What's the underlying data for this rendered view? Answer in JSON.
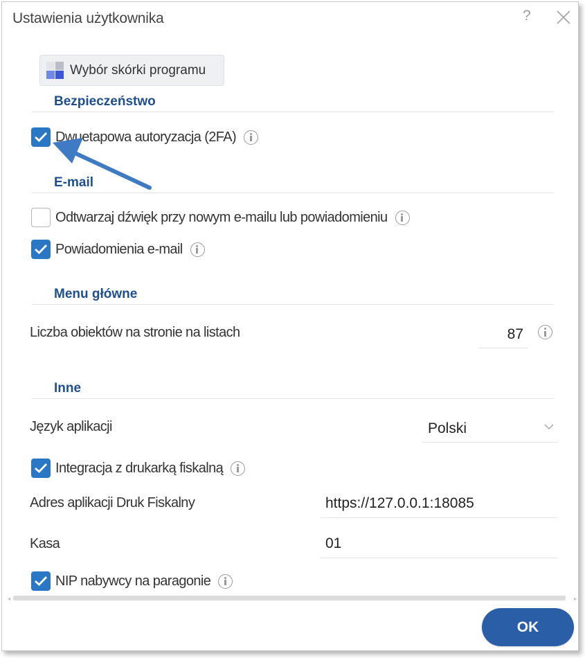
{
  "window": {
    "title": "Ustawienia użytkownika",
    "help_label": "?"
  },
  "skin_button": {
    "label": "Wybór skórki programu",
    "icon": "skin-palette-icon"
  },
  "sections": {
    "security": {
      "title": "Bezpieczeństwo",
      "two_factor": {
        "label": "Dwuetapowa autoryzacja (2FA)",
        "checked": true
      }
    },
    "email": {
      "title": "E-mail",
      "sound": {
        "label": "Odtwarzaj dźwięk przy nowym e-mailu lub powiadomieniu",
        "checked": false
      },
      "notifications": {
        "label": "Powiadomienia e-mail",
        "checked": true
      }
    },
    "main_menu": {
      "title": "Menu główne",
      "items_per_page": {
        "label": "Liczba obiektów na stronie na listach",
        "value": "87"
      }
    },
    "other": {
      "title": "Inne",
      "language": {
        "label": "Język aplikacji",
        "value": "Polski"
      },
      "fiscal_printer": {
        "label": "Integracja z drukarką fiskalną",
        "checked": true
      },
      "fiscal_address": {
        "label": "Adres aplikacji Druk Fiskalny",
        "value": "https://127.0.0.1:18085"
      },
      "register": {
        "label": "Kasa",
        "value": "01"
      },
      "buyer_nip": {
        "label": "NIP nabywcy na paragonie",
        "checked": true
      }
    }
  },
  "footer": {
    "ok_label": "OK"
  },
  "colors": {
    "accent": "#2a78c5",
    "section_title": "#1f4f8d",
    "ok_button": "#2a5fa8",
    "annotation_arrow": "#3f7bc4"
  }
}
